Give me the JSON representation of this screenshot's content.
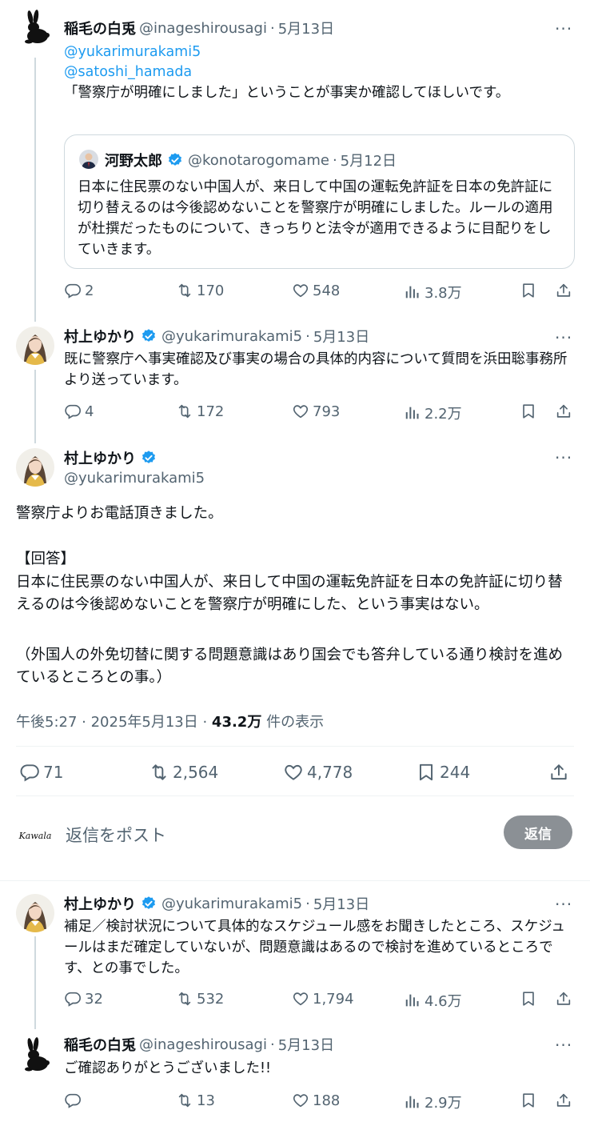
{
  "tweets": [
    {
      "name": "稲毛の白兎",
      "handle": "@inageshirousagi",
      "dot": "·",
      "date": "5月13日",
      "mentions": [
        "@yukarimurakami5",
        "@satoshi_hamada"
      ],
      "text": "「警察庁が明確にしました」ということが事実か確認してほしいです。",
      "quote": {
        "name": "河野太郎",
        "handle": "@konotarogomame",
        "dot": "·",
        "date": "5月12日",
        "text": "日本に住民票のない中国人が、来日して中国の運転免許証を日本の免許証に切り替えるのは今後認めないことを警察庁が明確にしました。ルールの適用が杜撰だったものについて、きっちりと法令が適用できるように目配りをしていきます。"
      },
      "replies": "2",
      "retweets": "170",
      "likes": "548",
      "views": "3.8万"
    },
    {
      "name": "村上ゆかり",
      "handle": "@yukarimurakami5",
      "dot": "·",
      "date": "5月13日",
      "text": "既に警察庁へ事実確認及び事実の場合の具体的内容について質問を浜田聡事務所より送っています。",
      "replies": "4",
      "retweets": "172",
      "likes": "793",
      "views": "2.2万"
    }
  ],
  "main": {
    "name": "村上ゆかり",
    "handle": "@yukarimurakami5",
    "paragraphs": [
      "警察庁よりお電話頂きました。",
      "",
      "【回答】",
      "日本に住民票のない中国人が、来日して中国の運転免許証を日本の免許証に切り替えるのは今後認めないことを警察庁が明確にした、という事実はない。",
      "（外国人の外免切替に関する問題意識はあり国会でも答弁している通り検討を進めているところとの事。）"
    ],
    "time": "午後5:27 · 2025年5月13日 · ",
    "views_count": "43.2万",
    "views_label": " 件の表示",
    "replies": "71",
    "retweets": "2,564",
    "likes": "4,778",
    "bookmarks": "244"
  },
  "composer": {
    "logo_text": "Kawala",
    "placeholder": "返信をポスト",
    "button": "返信"
  },
  "replies": [
    {
      "name": "村上ゆかり",
      "handle": "@yukarimurakami5",
      "dot": "·",
      "date": "5月13日",
      "text": "補足／検討状況について具体的なスケジュール感をお聞きしたところ、スケジュールはまだ確定していないが、問題意識はあるので検討を進めているところです、との事でした。",
      "replies": "32",
      "retweets": "532",
      "likes": "1,794",
      "views": "4.6万"
    },
    {
      "name": "稲毛の白兎",
      "handle": "@inageshirousagi",
      "dot": "·",
      "date": "5月13日",
      "text": "ご確認ありがとうございました!!",
      "replies": "",
      "retweets": "13",
      "likes": "188",
      "views": "2.9万"
    }
  ],
  "colors": {
    "accent": "#1d9bf0",
    "muted": "#536471",
    "border": "#cfd9de"
  },
  "icons": [
    "rabbit-avatar",
    "woman-avatar",
    "verified-icon",
    "more-icon",
    "reply-icon",
    "retweet-icon",
    "like-icon",
    "views-icon",
    "bookmark-icon",
    "share-icon"
  ]
}
